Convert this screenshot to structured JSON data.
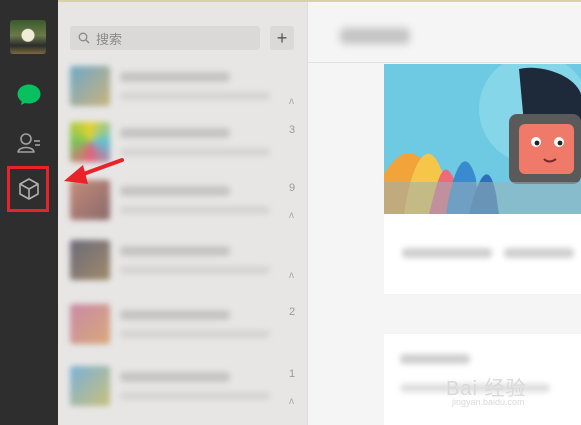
{
  "sidebar": {
    "nav": [
      {
        "name": "chat",
        "icon": "chat-bubble-icon",
        "active": true,
        "color": "#07c160"
      },
      {
        "name": "contacts",
        "icon": "contacts-icon",
        "active": false,
        "color": "#9a9a9a"
      },
      {
        "name": "mini-programs",
        "icon": "cube-icon",
        "active": false,
        "color": "#9a9a9a"
      }
    ],
    "highlight_color": "#e8232a"
  },
  "search": {
    "placeholder": "搜索",
    "icon": "search-icon"
  },
  "add_button": {
    "label": "+"
  },
  "chat_list": [
    {
      "time": "",
      "muted": true
    },
    {
      "time": "3",
      "muted": false
    },
    {
      "time": "9",
      "muted": true
    },
    {
      "time": "",
      "muted": true
    },
    {
      "time": "2",
      "muted": false
    },
    {
      "time": "1",
      "muted": true
    }
  ],
  "annotation": {
    "icon": "red-arrow-icon",
    "color": "#e8232a"
  },
  "watermark": {
    "text": "Bai 经验",
    "url": "jingyan.baidu.com"
  }
}
